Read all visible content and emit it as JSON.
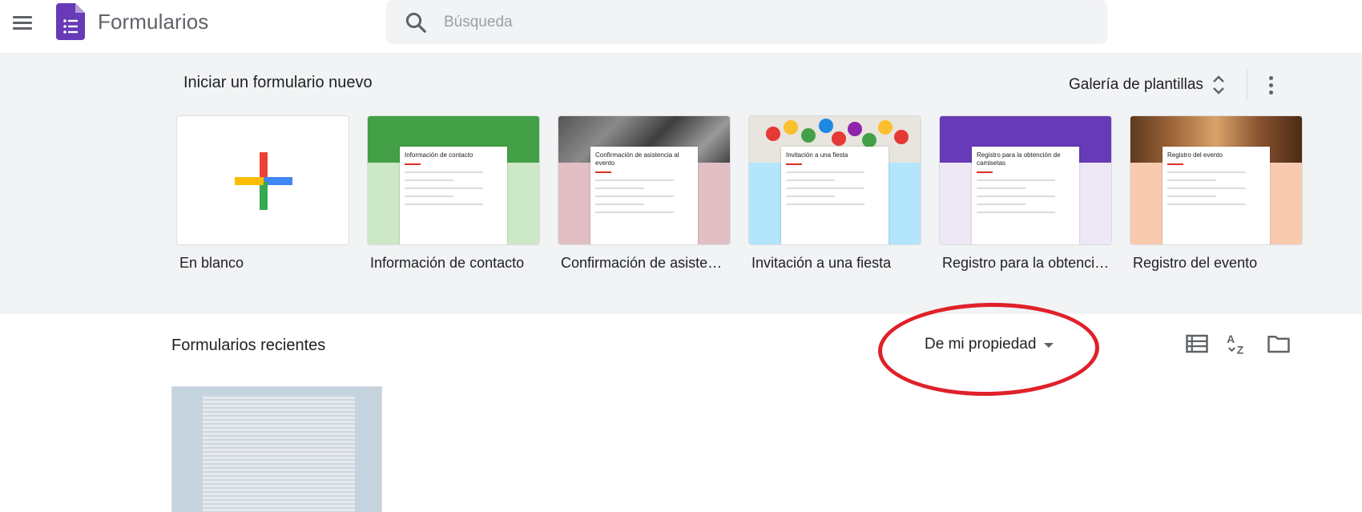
{
  "header": {
    "app_title": "Formularios",
    "search_placeholder": "Búsqueda"
  },
  "templates": {
    "section_title": "Iniciar un formulario nuevo",
    "gallery_label": "Galería de plantillas",
    "items": [
      {
        "label": "En blanco"
      },
      {
        "label": "Información de contacto",
        "preview_title": "Información de contacto"
      },
      {
        "label": "Confirmación de asistencia al evento",
        "preview_title": "Confirmación de asistencia al evento"
      },
      {
        "label": "Invitación a una fiesta",
        "preview_title": "Invitación a una fiesta"
      },
      {
        "label": "Registro para la obtención de camisetas",
        "preview_title": "Registro para la obtención de camisetas"
      },
      {
        "label": "Registro del evento",
        "preview_title": "Registro del evento"
      }
    ]
  },
  "recent": {
    "section_title": "Formularios recientes",
    "owner_filter": "De mi propiedad"
  },
  "colors": {
    "forms_purple": "#673ab7",
    "band_bg": "#f1f3f4",
    "annotation_red": "#e0202a",
    "contact_green": "#4caf50",
    "rsvp_pink": "#e2bfc4",
    "party_blue": "#b3e5fc",
    "tshirt_purple": "#673ab7",
    "event_peach": "#f8cbb1"
  }
}
